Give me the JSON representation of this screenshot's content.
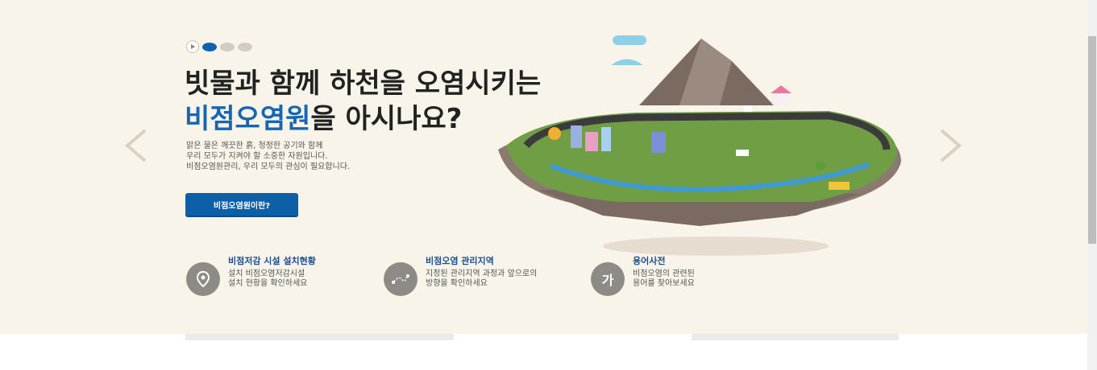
{
  "slider": {
    "active_index": 0,
    "dot_count": 3
  },
  "headline": {
    "line1": "빗물과 함께 하천을 오염시키는",
    "line2_highlight": "비점오염원",
    "line2_rest": "을 아시나요?"
  },
  "description": [
    "맑은 물은 깨끗한 흙, 청정한 공기와 함께",
    "우리 모두가 지켜야 할 소중한 자원입니다.",
    "비점오염원관리, 우리 모두의 관심이 필요합니다."
  ],
  "cta": {
    "label": "비점오염원이란?"
  },
  "quick_links": [
    {
      "title": "비점저감 시설 설치현황",
      "desc1": "설치 비점오염저감시설",
      "desc2": "설치 현황을 확인하세요",
      "icon": "map-pin-icon"
    },
    {
      "title": "비점오염 관리지역",
      "desc1": "지정된 관리지역 과정과 앞으로의",
      "desc2": "방향을 확인하세요",
      "icon": "route-icon"
    },
    {
      "title": "용어사전",
      "desc1": "비점오염의 관련된",
      "desc2": "용어를 찾아보세요",
      "icon": "dictionary-icon",
      "icon_text": "가"
    }
  ],
  "colors": {
    "background": "#f9f4ea",
    "accent": "#0d5fa8",
    "highlight": "#1566b3",
    "icon_circle": "#8e8b86"
  }
}
